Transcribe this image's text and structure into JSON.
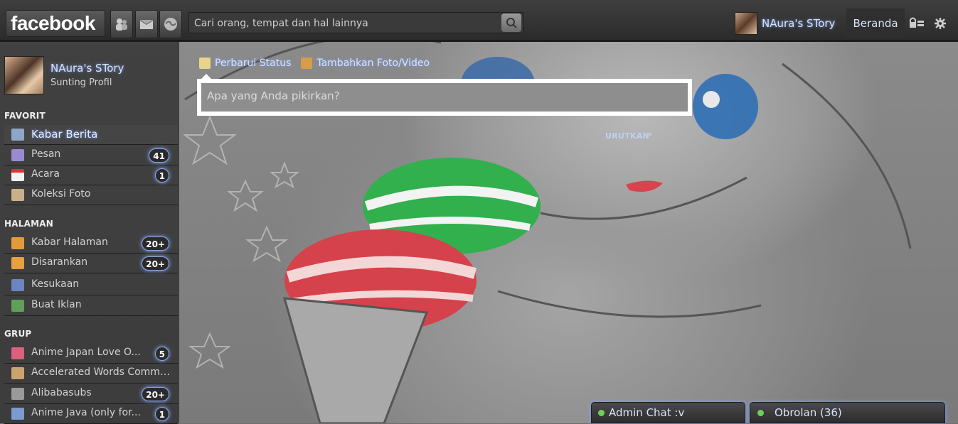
{
  "topbar": {
    "logo": "facebook",
    "jewels": [
      "friend-requests-icon",
      "messages-icon",
      "notifications-icon"
    ],
    "search": {
      "placeholder": "Cari orang, tempat dan hal lainnya",
      "value": ""
    },
    "profile_name": "NAura's STory",
    "home_label": "Beranda"
  },
  "sidebar": {
    "user": {
      "name": "NAura's STory",
      "edit_label": "Sunting Profil"
    },
    "favorites_title": "FAVORIT",
    "favorites": [
      {
        "label": "Kabar Berita",
        "count": "",
        "icon": "news-feed-icon",
        "active": true
      },
      {
        "label": "Pesan",
        "count": "41",
        "icon": "messages-icon"
      },
      {
        "label": "Acara",
        "count": "1",
        "icon": "calendar-icon"
      },
      {
        "label": "Koleksi Foto",
        "count": "",
        "icon": "photos-icon"
      }
    ],
    "pages_title": "HALAMAN",
    "pages": [
      {
        "label": "Kabar Halaman",
        "count": "20+",
        "icon": "pages-feed-icon"
      },
      {
        "label": "Disarankan",
        "count": "20+",
        "icon": "suggested-icon"
      },
      {
        "label": "Kesukaan",
        "count": "",
        "icon": "like-icon"
      },
      {
        "label": "Buat Iklan",
        "count": "",
        "icon": "create-ad-icon"
      }
    ],
    "groups_title": "GRUP",
    "groups": [
      {
        "label": "Anime Japan Love O...",
        "count": "5",
        "icon": "group-icon"
      },
      {
        "label": "Accelerated Words Commu...",
        "count": "",
        "icon": "group-icon"
      },
      {
        "label": "Alibabasubs",
        "count": "20+",
        "icon": "group-icon"
      },
      {
        "label": "Anime Java (only for...",
        "count": "1",
        "icon": "group-icon"
      }
    ]
  },
  "composer": {
    "update_status": "Perbarui Status",
    "add_photo": "Tambahkan Foto/Video",
    "placeholder": "Apa yang Anda pikirkan?"
  },
  "feed": {
    "sort_label": "URUTKAN"
  },
  "chat": {
    "admin_chat": "Admin Chat :v",
    "chat_label": "Obrolan (36)"
  },
  "colors": {
    "accent": "#7ba0ff",
    "topbar": "#333333",
    "online": "#6fcf5b"
  }
}
